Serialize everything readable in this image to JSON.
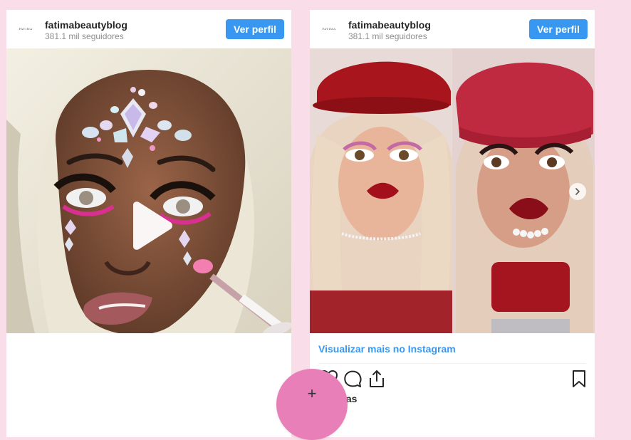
{
  "posts": [
    {
      "account_name": "fatimabeautyblog",
      "followers": "381.1 mil seguidores",
      "avatar_text": "fatima",
      "view_profile_label": "Ver perfil",
      "media_type": "video"
    },
    {
      "account_name": "fatimabeautyblog",
      "followers": "381.1 mil seguidores",
      "avatar_text": "fatima",
      "view_profile_label": "Ver perfil",
      "media_type": "carousel",
      "view_more_label": "Visualizar mais no Instagram",
      "likes_label": "curtidas"
    }
  ],
  "fab_label": "+",
  "colors": {
    "background": "#f9dde9",
    "accent": "#3897f0",
    "fab": "#e87fb8"
  },
  "icons": {
    "play": "play-icon",
    "next": "chevron-right-icon",
    "like": "heart-icon",
    "comment": "comment-icon",
    "share": "share-icon",
    "save": "bookmark-icon"
  }
}
